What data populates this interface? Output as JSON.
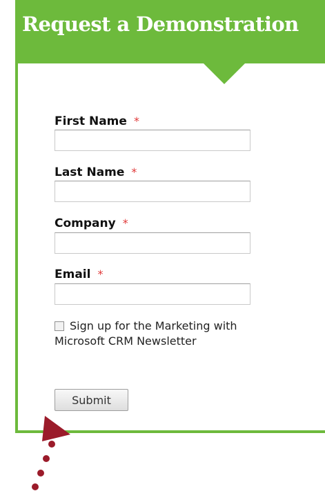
{
  "header": {
    "title": "Request a Demonstration"
  },
  "form": {
    "fields": [
      {
        "label": "First Name",
        "required_mark": "*",
        "value": ""
      },
      {
        "label": "Last Name",
        "required_mark": "*",
        "value": ""
      },
      {
        "label": "Company",
        "required_mark": "*",
        "value": ""
      },
      {
        "label": "Email",
        "required_mark": "*",
        "value": ""
      }
    ],
    "newsletter": {
      "checked": false,
      "label": "Sign up for the Marketing with Microsoft CRM Newsletter"
    },
    "submit_label": "Submit"
  },
  "colors": {
    "brand_green": "#6dba3c",
    "required_red": "#e03a3a",
    "annotation_arrow": "#9b1b2a"
  }
}
